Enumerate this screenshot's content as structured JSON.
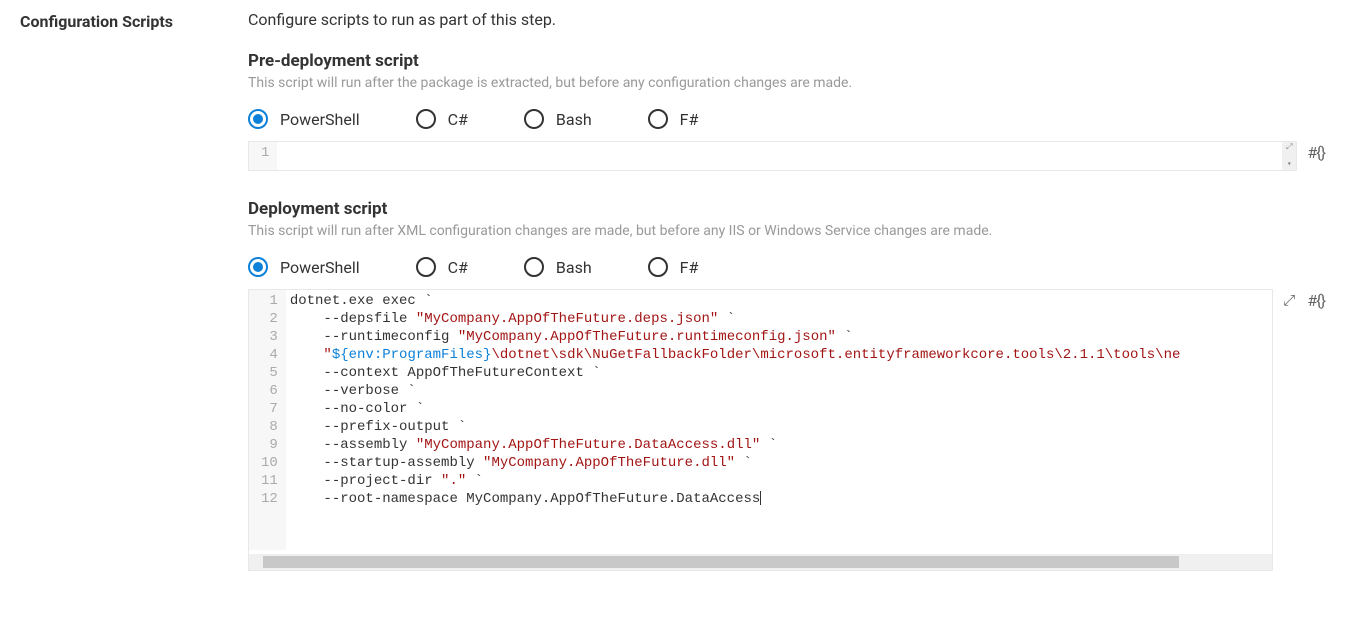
{
  "section": {
    "title": "Configuration Scripts",
    "desc": "Configure scripts to run as part of this step."
  },
  "langs": [
    "PowerShell",
    "C#",
    "Bash",
    "F#"
  ],
  "predeploy": {
    "title": "Pre-deployment script",
    "sub": "This script will run after the package is extracted, but before any configuration changes are made.",
    "selected": "PowerShell",
    "lines": [
      ""
    ]
  },
  "deploy": {
    "title": "Deployment script",
    "sub": "This script will run after XML configuration changes are made, but before any IIS or Windows Service changes are made.",
    "selected": "PowerShell",
    "lines": [
      [
        {
          "t": "dotnet.exe exec `"
        }
      ],
      [
        {
          "t": "    --depsfile "
        },
        {
          "t": "\"MyCompany.AppOfTheFuture.deps.json\"",
          "c": "str"
        },
        {
          "t": " `"
        }
      ],
      [
        {
          "t": "    --runtimeconfig "
        },
        {
          "t": "\"MyCompany.AppOfTheFuture.runtimeconfig.json\"",
          "c": "str"
        },
        {
          "t": " `"
        }
      ],
      [
        {
          "t": "    "
        },
        {
          "t": "\"",
          "c": "str"
        },
        {
          "t": "${env:ProgramFiles}",
          "c": "var"
        },
        {
          "t": "\\dotnet\\sdk\\NuGetFallbackFolder\\microsoft.entityframeworkcore.tools\\2.1.1\\tools\\ne",
          "c": "str"
        }
      ],
      [
        {
          "t": "    --context AppOfTheFutureContext `"
        }
      ],
      [
        {
          "t": "    --verbose `"
        }
      ],
      [
        {
          "t": "    --no-color `"
        }
      ],
      [
        {
          "t": "    --prefix-output `"
        }
      ],
      [
        {
          "t": "    --assembly "
        },
        {
          "t": "\"MyCompany.AppOfTheFuture.DataAccess.dll\"",
          "c": "str"
        },
        {
          "t": " `"
        }
      ],
      [
        {
          "t": "    --startup-assembly "
        },
        {
          "t": "\"MyCompany.AppOfTheFuture.dll\"",
          "c": "str"
        },
        {
          "t": " `"
        }
      ],
      [
        {
          "t": "    --project-dir "
        },
        {
          "t": "\".\"",
          "c": "str"
        },
        {
          "t": " `"
        }
      ],
      [
        {
          "t": "    --root-namespace MyCompany.AppOfTheFuture.DataAccess"
        }
      ]
    ]
  }
}
